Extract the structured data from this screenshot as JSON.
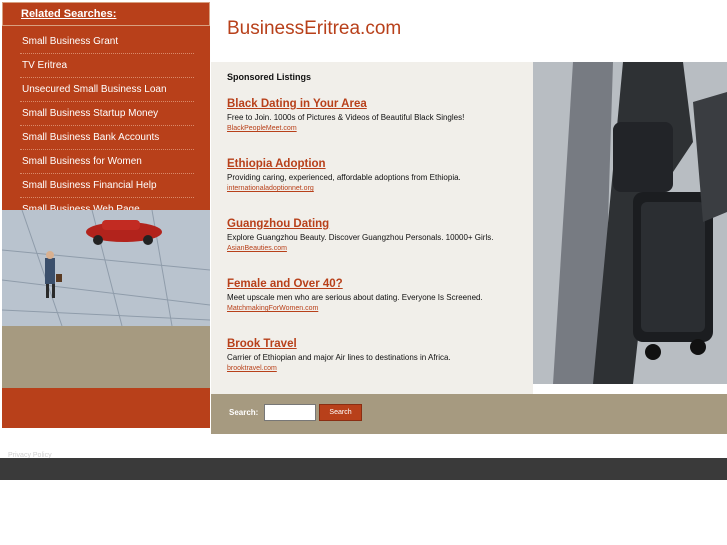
{
  "site": {
    "title": "BusinessEritrea.com"
  },
  "sidebar": {
    "heading": "Related Searches:",
    "items": [
      "Small Business Grant",
      "TV Eritrea",
      "Unsecured Small Business Loan",
      "Small Business Startup Money",
      "Small Business Bank Accounts",
      "Small Business for Women",
      "Small Business Financial Help",
      "Small Business Web Page"
    ]
  },
  "sponsored": {
    "heading": "Sponsored Listings",
    "listings": [
      {
        "title": "Black Dating in Your Area",
        "desc": "Free to Join. 1000s of Pictures & Videos of Beautiful Black Singles!",
        "url": "BlackPeopleMeet.com"
      },
      {
        "title": "Ethiopia Adoption",
        "desc": "Providing caring, experienced, affordable adoptions from Ethiopia.",
        "url": "internationaladoptionnet.org"
      },
      {
        "title": "Guangzhou Dating",
        "desc": "Explore Guangzhou Beauty. Discover Guangzhou Personals. 10000+ Girls.",
        "url": "AsianBeauties.com"
      },
      {
        "title": "Female and Over 40? ",
        "desc": "Meet upscale men who are serious about dating. Everyone Is Screened.",
        "url": "MatchmakingForWomen.com"
      },
      {
        "title": "Brook Travel",
        "desc": "Carrier of Ethiopian and major Air lines to destinations in Africa.",
        "url": "brooktravel.com"
      }
    ]
  },
  "search": {
    "label": "Search:",
    "button": "Search",
    "value": ""
  },
  "footer": {
    "privacy": "Privacy Policy"
  },
  "colors": {
    "accent": "#b8401a",
    "tan": "#a69a80",
    "content_bg": "#f1efea",
    "footer": "#3a3a3a"
  }
}
